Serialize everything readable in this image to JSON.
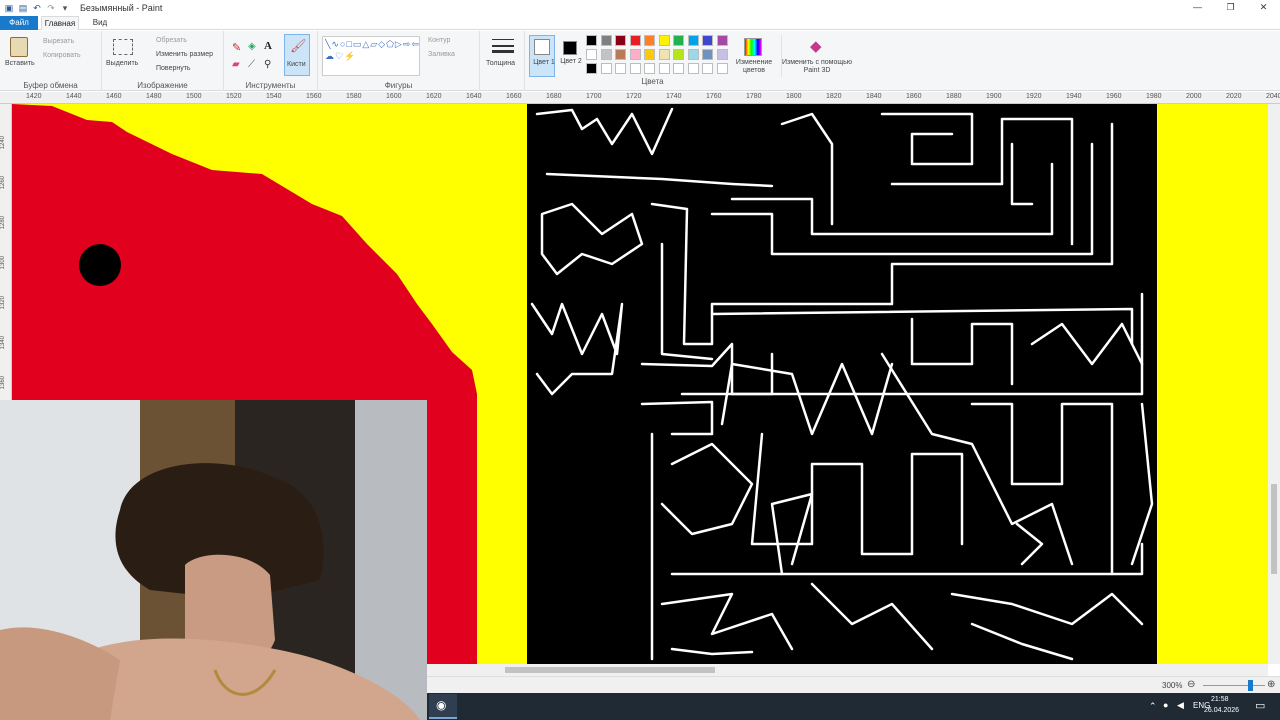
{
  "window": {
    "title": "Безымянный - Paint",
    "controls": [
      "minimize",
      "maximize",
      "close"
    ]
  },
  "tabs": {
    "file": "Файл",
    "home": "Главная",
    "view": "Вид"
  },
  "ribbon": {
    "clipboard": {
      "label": "Буфер обмена",
      "paste": "Вставить",
      "cut": "Вырезать",
      "copy": "Копировать"
    },
    "image": {
      "label": "Изображение",
      "select": "Выделить",
      "crop": "Обрезать",
      "resize": "Изменить размер",
      "rotate": "Повернуть"
    },
    "tools": {
      "label": "Инструменты",
      "brushes": "Кисти"
    },
    "shapes": {
      "label": "Фигуры",
      "outline": "Контур",
      "fill": "Заливка"
    },
    "thickness": "Толщина",
    "color1": "Цвет 1",
    "color2": "Цвет 2",
    "colors_label": "Цвета",
    "edit_colors": "Изменение цветов",
    "paint3d": "Изменить с помощью Paint 3D",
    "palette": [
      "#000000",
      "#7f7f7f",
      "#880015",
      "#ed1c24",
      "#ff7f27",
      "#fff200",
      "#22b14c",
      "#00a2e8",
      "#3f48cc",
      "#a349a4",
      "#ffffff",
      "#c3c3c3",
      "#b97a57",
      "#ffaec9",
      "#ffc90e",
      "#efe4b0",
      "#b5e61d",
      "#99d9ea",
      "#7092be",
      "#c8bfe7",
      "#000000",
      "#ffffff",
      "#ffffff",
      "#ffffff",
      "#ffffff",
      "#ffffff",
      "#ffffff",
      "#ffffff",
      "#ffffff",
      "#ffffff"
    ]
  },
  "ruler": {
    "h_ticks": [
      "1420",
      "1440",
      "1460",
      "1480",
      "1500",
      "1520",
      "1540",
      "1560",
      "1580",
      "1600",
      "1620",
      "1640",
      "1660",
      "1680",
      "1700",
      "1720",
      "1740",
      "1760",
      "1780",
      "1800",
      "1820",
      "1840",
      "1860",
      "1880",
      "1900",
      "1920",
      "1940",
      "1960",
      "1980",
      "2000",
      "2020",
      "2040"
    ],
    "v_ticks": [
      "1240",
      "1260",
      "1280",
      "1300",
      "1320",
      "1340",
      "1360"
    ]
  },
  "status": {
    "zoom": "300%",
    "zoom_level": 0.72
  },
  "taskbar": {
    "lang": "ENG",
    "time": "21:58",
    "date": "26.04.2026"
  },
  "colors": {
    "canvas_bg": "#ffff00",
    "red_shape": "#e1001e",
    "maze_bg": "#000000",
    "maze_line": "#ffffff",
    "accent": "#1979ca"
  }
}
